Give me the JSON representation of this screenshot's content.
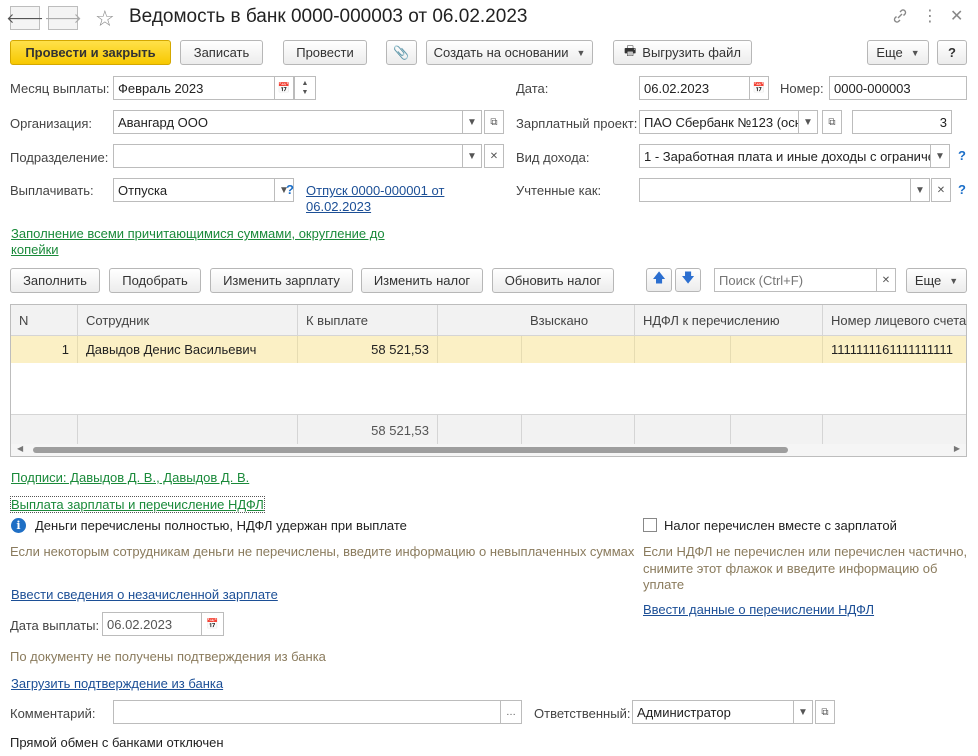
{
  "window": {
    "title": "Ведомость в банк 0000-000003 от 06.02.2023"
  },
  "toolbar": {
    "post_close": "Провести и закрыть",
    "save": "Записать",
    "post": "Провести",
    "create_based": "Создать на основании",
    "export_file": "Выгрузить файл",
    "more": "Еще",
    "help": "?"
  },
  "form": {
    "pay_month_label": "Месяц выплаты:",
    "pay_month_value": "Февраль 2023",
    "date_label": "Дата:",
    "date_value": "06.02.2023",
    "number_label": "Номер:",
    "number_value": "0000-000003",
    "org_label": "Организация:",
    "org_value": "Авангард ООО",
    "salary_project_label": "Зарплатный проект:",
    "salary_project_value": "ПАО Сбербанк №123 (осн",
    "salary_project_num": "3",
    "division_label": "Подразделение:",
    "division_value": "",
    "income_type_label": "Вид дохода:",
    "income_type_value": "1 - Заработная плата и иные доходы с ограничен",
    "pay_label": "Выплачивать:",
    "pay_value": "Отпуска",
    "vacation_link": "Отпуск 0000-000001 от",
    "vacation_link2": "06.02.2023",
    "accounted_label": "Учтенные как:",
    "accounted_value": "",
    "fill_link": "Заполнение всеми причитающимися суммами, округление до",
    "fill_link2": "копейки"
  },
  "table_toolbar": {
    "fill": "Заполнить",
    "select": "Подобрать",
    "change_salary": "Изменить зарплату",
    "change_tax": "Изменить налог",
    "update_tax": "Обновить налог",
    "search_placeholder": "Поиск (Ctrl+F)",
    "more": "Еще"
  },
  "table": {
    "columns": [
      "N",
      "Сотрудник",
      "К выплате",
      "Взыскано",
      "НДФЛ к перечислению",
      "Номер лицевого счета"
    ],
    "rows": [
      {
        "n": "1",
        "employee": "Давыдов Денис Васильевич",
        "to_pay": "58 521,53",
        "collected": "",
        "ndfl": "",
        "account": "1111111161111111111"
      }
    ],
    "total_to_pay": "58 521,53"
  },
  "bottom": {
    "signatures_link": "Подписи: Давыдов Д. В., Давыдов Д. В.",
    "payment_link": "Выплата зарплаты и перечисление НДФЛ",
    "money_status": "Деньги перечислены  полностью, НДФЛ удержан при выплате",
    "money_hint": "Если некоторым сотрудникам деньги не перечислены, введите информацию о невыплаченных суммах",
    "tax_checkbox_label": "Налог перечислен вместе с зарплатой",
    "tax_hint1": "Если НДФЛ не перечислен или перечислен частично,",
    "tax_hint2": "снимите этот флажок и введите информацию об",
    "tax_hint3": "уплате",
    "unaccrued_link": "Ввести сведения о незачисленной зарплате",
    "ndfl_link": "Ввести данные о перечислении НДФЛ",
    "pay_date_label": "Дата выплаты:",
    "pay_date_value": "06.02.2023",
    "no_confirm": "По документу не получены подтверждения из банка",
    "load_confirm_link": "Загрузить подтверждение из банка",
    "comment_label": "Комментарий:",
    "comment_value": "",
    "responsible_label": "Ответственный:",
    "responsible_value": "Администратор",
    "bank_exchange": "Прямой обмен с банками отключен"
  }
}
